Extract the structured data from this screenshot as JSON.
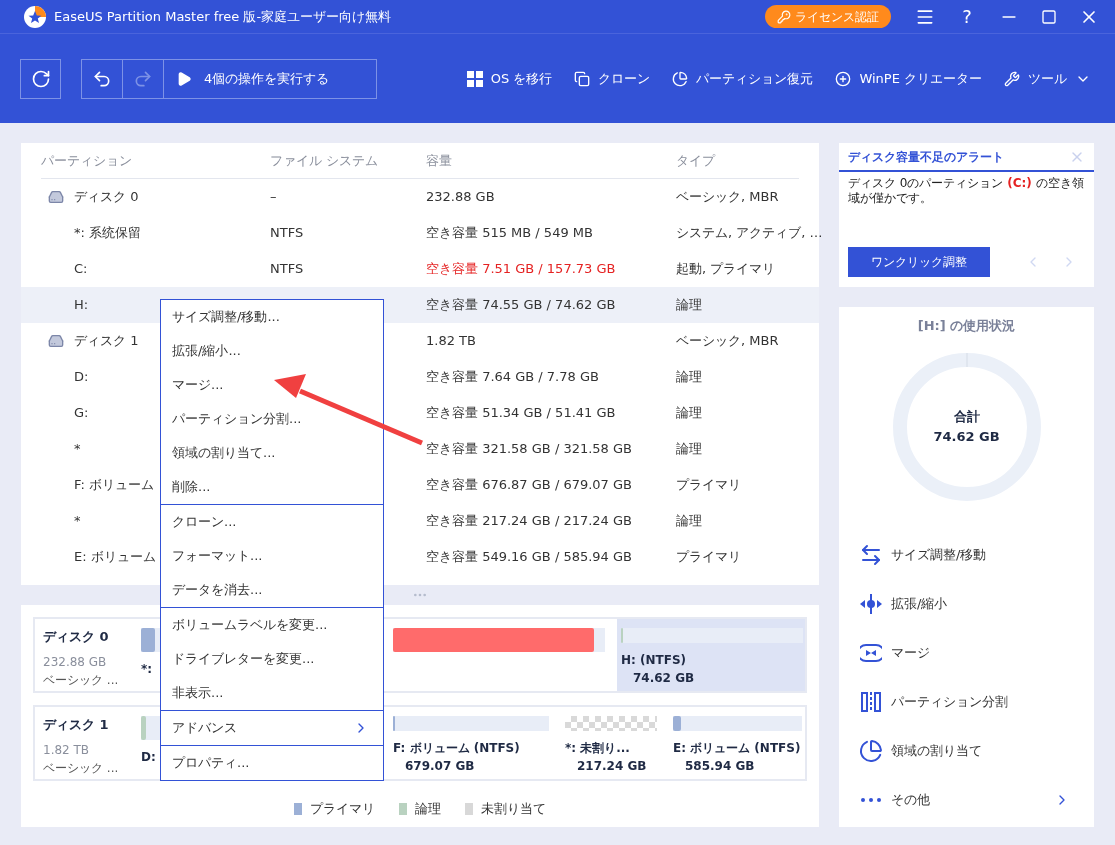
{
  "window": {
    "title": "EaseUS Partition Master free 版-家庭ユーザー向け無料",
    "license_button": "ライセンス認証",
    "help_glyph": "?"
  },
  "toolbar": {
    "undo_disabled": false,
    "redo_disabled": true,
    "execute": "4個の操作を実行する",
    "actions": [
      {
        "kind": "os",
        "label": "OS を移行"
      },
      {
        "kind": "clone",
        "label": "クローン"
      },
      {
        "kind": "recovery",
        "label": "パーティション復元"
      },
      {
        "kind": "winpe",
        "label": "WinPE クリエーター"
      },
      {
        "kind": "tools",
        "label": "ツール"
      }
    ]
  },
  "table": {
    "columns": [
      "パーティション",
      "ファイル システム",
      "容量",
      "タイプ"
    ],
    "rows": [
      {
        "kind": "disk",
        "name": "ディスク 0",
        "fs": "–",
        "capacity": "232.88 GB",
        "type": "ベーシック, MBR",
        "selected": false,
        "low_space": false
      },
      {
        "kind": "partition",
        "name": "*: 系统保留",
        "fs": "NTFS",
        "capacity": "空き容量 515 MB / 549 MB",
        "type": "システム, アクティブ, …",
        "selected": false,
        "low_space": false
      },
      {
        "kind": "partition",
        "name": "C:",
        "fs": "NTFS",
        "capacity": "空き容量 7.51 GB / 157.73 GB",
        "type": "起動, プライマリ",
        "selected": false,
        "low_space": true
      },
      {
        "kind": "partition",
        "name": "H:",
        "capacity": "空き容量 74.55 GB / 74.62 GB",
        "type": "論理",
        "selected": true,
        "low_space": false
      },
      {
        "kind": "disk",
        "name": "ディスク 1",
        "capacity": "1.82 TB",
        "type": "ベーシック, MBR",
        "selected": false,
        "low_space": false
      },
      {
        "kind": "partition",
        "name": "D:",
        "capacity": "空き容量 7.64 GB / 7.78 GB",
        "type": "論理",
        "selected": false,
        "low_space": false
      },
      {
        "kind": "partition",
        "name": "G:",
        "capacity": "空き容量 51.34 GB / 51.41 GB",
        "type": "論理",
        "selected": false,
        "low_space": false
      },
      {
        "kind": "partition",
        "name": "*",
        "capacity": "空き容量 321.58 GB / 321.58 GB",
        "type": "論理",
        "selected": false,
        "low_space": false
      },
      {
        "kind": "partition",
        "name": "F: ボリューム",
        "capacity": "空き容量 676.87 GB / 679.07 GB",
        "type": "プライマリ",
        "selected": false,
        "low_space": false
      },
      {
        "kind": "partition",
        "name": "*",
        "capacity": "空き容量 217.24 GB / 217.24 GB",
        "type": "論理",
        "selected": false,
        "low_space": false
      },
      {
        "kind": "partition",
        "name": "E: ボリューム",
        "capacity": "空き容量 549.16 GB / 585.94 GB",
        "type": "プライマリ",
        "selected": false,
        "low_space": false
      }
    ]
  },
  "context_menu": {
    "groups": [
      {
        "items": [
          {
            "label": "サイズ調整/移動...",
            "submenu": false
          },
          {
            "label": "拡張/縮小...",
            "submenu": false
          },
          {
            "label": "マージ...",
            "submenu": false
          },
          {
            "label": "パーティション分割...",
            "submenu": false
          },
          {
            "label": "領域の割り当て...",
            "submenu": false
          },
          {
            "label": "削除...",
            "submenu": false
          }
        ]
      },
      {
        "items": [
          {
            "label": "クローン...",
            "submenu": false
          },
          {
            "label": "フォーマット...",
            "submenu": false
          },
          {
            "label": "データを消去...",
            "submenu": false
          }
        ]
      },
      {
        "items": [
          {
            "label": "ボリュームラベルを変更...",
            "submenu": false
          },
          {
            "label": "ドライブレターを変更...",
            "submenu": false
          },
          {
            "label": "非表示...",
            "submenu": false
          }
        ]
      },
      {
        "items": [
          {
            "label": "アドバンス",
            "submenu": true
          }
        ]
      },
      {
        "items": [
          {
            "label": "プロパティ...",
            "submenu": false
          }
        ]
      }
    ]
  },
  "disk_map": {
    "disks": [
      {
        "name": "ディスク 0",
        "size": "232.88 GB",
        "type": "ベーシック ...",
        "segments": [
          {
            "kind": "primary",
            "label": "*:",
            "level": 0.06,
            "selected": false,
            "low_space": false
          },
          {
            "kind": "primary",
            "level": 0.95,
            "selected": false,
            "low_space": true
          },
          {
            "kind": "logical",
            "label": "H: (NTFS)",
            "size": "74.62 GB",
            "level": 0.01,
            "selected": true,
            "low_space": false
          }
        ]
      },
      {
        "name": "ディスク 1",
        "size": "1.82 TB",
        "type": "ベーシック ...",
        "segments": [
          {
            "kind": "logical",
            "label": "D:",
            "level": 0.02,
            "selected": false,
            "low_space": false
          },
          {
            "kind": "primary",
            "label": "F: ボリューム (NTFS)",
            "size": "679.07 GB",
            "level": 0.01,
            "selected": false,
            "low_space": false
          },
          {
            "kind": "unallocated",
            "label": "*: 未割り...",
            "size": "217.24 GB",
            "selected": false
          },
          {
            "kind": "primary",
            "label": "E: ボリューム (NTFS)",
            "size": "585.94 GB",
            "level": 0.063,
            "selected": false,
            "low_space": false
          }
        ]
      }
    ],
    "legend": [
      {
        "kind": "primary",
        "label": "プライマリ"
      },
      {
        "kind": "logical",
        "label": "論理"
      },
      {
        "kind": "unallocated",
        "label": "未割り当て"
      }
    ]
  },
  "alert": {
    "title": "ディスク容量不足のアラート",
    "message": "ディスク 0のパーティション **(C:)** の空き領域が僅かです。",
    "button": "ワンクリック調整"
  },
  "usage": {
    "title": "[H:] の使用状況",
    "total_label": "合計",
    "total": "74.62 GB",
    "actions": [
      {
        "kind": "resize",
        "label": "サイズ調整/移動"
      },
      {
        "kind": "extend",
        "label": "拡張/縮小"
      },
      {
        "kind": "merge",
        "label": "マージ"
      },
      {
        "kind": "split",
        "label": "パーティション分割"
      },
      {
        "kind": "allocate",
        "label": "領域の割り当て"
      },
      {
        "kind": "more",
        "label": "その他"
      }
    ]
  }
}
